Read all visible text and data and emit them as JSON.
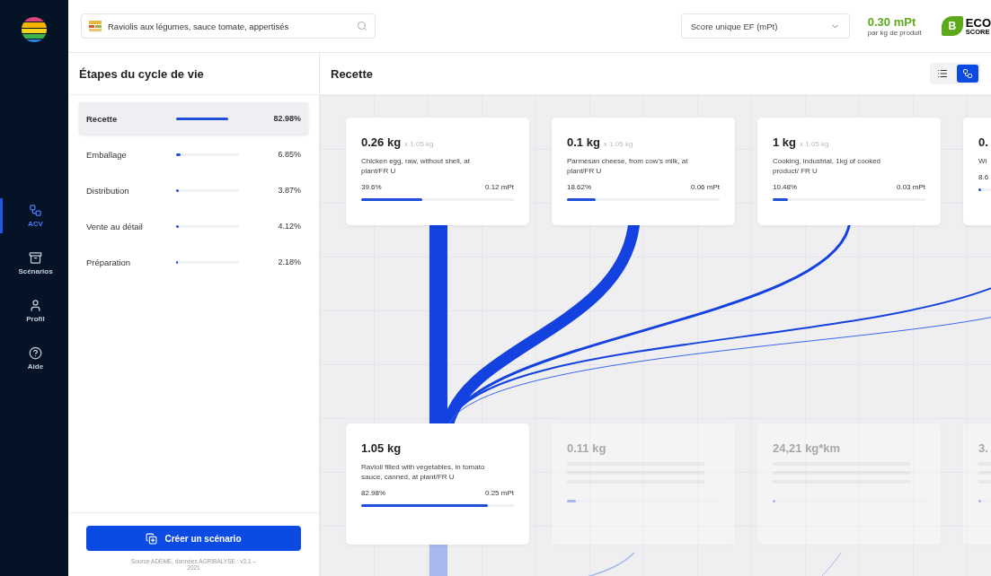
{
  "sidebar": {
    "items": [
      {
        "label": "ACV",
        "selected": true
      },
      {
        "label": "Scénarios",
        "selected": false
      },
      {
        "label": "Profil",
        "selected": false
      },
      {
        "label": "Aide",
        "selected": false
      }
    ]
  },
  "header": {
    "search": {
      "value": "Raviolis aux légumes, sauce tomate, appertisés"
    },
    "select": {
      "value": "Score unique EF (mPt)"
    },
    "score": {
      "value": "0.30 mPt",
      "unit": "par kg de produit"
    },
    "ecoscore": {
      "grade": "B",
      "word": "ECO",
      "sub": "SCORE"
    }
  },
  "stages": {
    "title": "Étapes du cycle de vie",
    "items": [
      {
        "label": "Recette",
        "level": 0.83,
        "value": "82.98%",
        "selected": true
      },
      {
        "label": "Emballage",
        "level": 0.07,
        "value": "6.85%",
        "selected": false
      },
      {
        "label": "Distribution",
        "level": 0.04,
        "value": "3.87%",
        "selected": false
      },
      {
        "label": "Vente au détail",
        "level": 0.04,
        "value": "4.12%",
        "selected": false
      },
      {
        "label": "Préparation",
        "level": 0.02,
        "value": "2.18%",
        "selected": false
      }
    ],
    "button": "Créer un scénario",
    "source": "Source ADEME, données AGRIBALYSE : v3.1 – 2021"
  },
  "recipe": {
    "title": "Recette",
    "views": [
      {
        "kind": "list",
        "selected": false
      },
      {
        "kind": "tree",
        "selected": true
      }
    ],
    "inputs": [
      {
        "amount": "0.26 kg",
        "factor": "x 1.05 kg",
        "name": "Chicken egg, raw, without shell, at plant/FR U",
        "share": "39.6%",
        "score": "0.12 mPt",
        "level": 0.4
      },
      {
        "amount": "0.1 kg",
        "factor": "x 1.05 kg",
        "name": "Parmesan cheese, from cow's milk, at plant/FR U",
        "share": "18.62%",
        "score": "0.06 mPt",
        "level": 0.19
      },
      {
        "amount": "1 kg",
        "factor": "x 1.05 kg",
        "name": "Cooking, industrial, 1kg of cooked product/ FR U",
        "share": "10.48%",
        "score": "0.03 mPt",
        "level": 0.1
      },
      {
        "amount": "0.",
        "name": "Wi",
        "share": "8.6",
        "level": 0.02
      }
    ],
    "outputs": [
      {
        "kind": "full",
        "amount": "1.05 kg",
        "name": "Ravioli filled with vegetables, in tomato sauce, canned, at plant/FR U",
        "share": "82.98%",
        "score": "0.25 mPt",
        "level": 0.83
      },
      {
        "kind": "faded",
        "amount": "0.11 kg",
        "level": 0.06
      },
      {
        "kind": "faded",
        "amount": "24,21 kg*km",
        "level": 0.02
      },
      {
        "kind": "faded",
        "amount": "3.",
        "level": 0.02
      }
    ]
  }
}
